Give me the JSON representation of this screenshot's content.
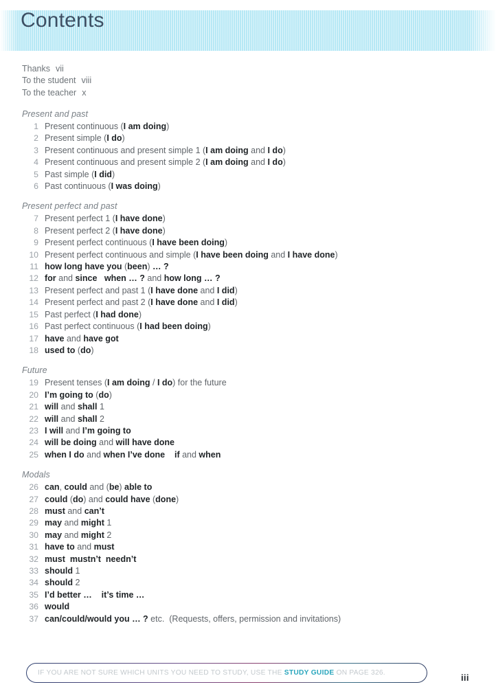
{
  "header": {
    "title": "Contents",
    "accent_color": "#b6e8f5"
  },
  "frontmatter": [
    {
      "label": "Thanks",
      "page": "vii"
    },
    {
      "label": "To the student",
      "page": "viii"
    },
    {
      "label": "To the teacher",
      "page": "x"
    }
  ],
  "sections": [
    {
      "title": "Present and past",
      "entries": [
        {
          "num": "1",
          "html": "Present continuous (<b>I am doing</b>)"
        },
        {
          "num": "2",
          "html": "Present simple (<b>I do</b>)"
        },
        {
          "num": "3",
          "html": "Present continuous and present simple 1 (<b>I am doing</b> and <b>I do</b>)"
        },
        {
          "num": "4",
          "html": "Present continuous and present simple 2 (<b>I am doing</b> and <b>I do</b>)"
        },
        {
          "num": "5",
          "html": "Past simple (<b>I did</b>)"
        },
        {
          "num": "6",
          "html": "Past continuous (<b>I was doing</b>)"
        }
      ]
    },
    {
      "title": "Present perfect and past",
      "entries": [
        {
          "num": "7",
          "html": "Present perfect 1 (<b>I have done</b>)"
        },
        {
          "num": "8",
          "html": "Present perfect 2 (<b>I have done</b>)"
        },
        {
          "num": "9",
          "html": "Present perfect continuous (<b>I have been doing</b>)"
        },
        {
          "num": "10",
          "html": "Present perfect continuous and simple (<b>I have been doing</b> and <b>I have done</b>)"
        },
        {
          "num": "11",
          "html": "<b>how long have you</b> (<b>been</b>) <b>… ?</b>"
        },
        {
          "num": "12",
          "html": "<b>for</b> and <b>since</b>   <b>when … ?</b> and <b>how long … ?</b>"
        },
        {
          "num": "13",
          "html": "Present perfect and past 1 (<b>I have done</b> and <b>I did</b>)"
        },
        {
          "num": "14",
          "html": "Present perfect and past 2 (<b>I have done</b> and <b>I did</b>)"
        },
        {
          "num": "15",
          "html": "Past perfect (<b>I had done</b>)"
        },
        {
          "num": "16",
          "html": "Past perfect continuous (<b>I had been doing</b>)"
        },
        {
          "num": "17",
          "html": "<b>have</b> and <b>have got</b>"
        },
        {
          "num": "18",
          "html": "<b>used to</b> (<b>do</b>)"
        }
      ]
    },
    {
      "title": "Future",
      "entries": [
        {
          "num": "19",
          "html": "Present tenses (<b>I am doing</b> / <b>I do</b>) for the future"
        },
        {
          "num": "20",
          "html": "<b>I’m going to</b> (<b>do</b>)"
        },
        {
          "num": "21",
          "html": "<b>will</b> and <b>shall</b> 1"
        },
        {
          "num": "22",
          "html": "<b>will</b> and <b>shall</b> 2"
        },
        {
          "num": "23",
          "html": "<b>I will</b> and <b>I’m going to</b>"
        },
        {
          "num": "24",
          "html": "<b>will be doing</b> and <b>will have done</b>"
        },
        {
          "num": "25",
          "html": "<b>when I do</b> and <b>when I’ve done</b>    <b>if</b> and <b>when</b>"
        }
      ]
    },
    {
      "title": "Modals",
      "entries": [
        {
          "num": "26",
          "html": "<b>can</b>, <b>could</b> and (<b>be</b>) <b>able to</b>"
        },
        {
          "num": "27",
          "html": "<b>could</b> (<b>do</b>) and <b>could have</b> (<b>done</b>)"
        },
        {
          "num": "28",
          "html": "<b>must</b> and <b>can’t</b>"
        },
        {
          "num": "29",
          "html": "<b>may</b> and <b>might</b> 1"
        },
        {
          "num": "30",
          "html": "<b>may</b> and <b>might</b> 2"
        },
        {
          "num": "31",
          "html": "<b>have to</b> and <b>must</b>"
        },
        {
          "num": "32",
          "html": "<b>must</b>  <b>mustn’t</b>  <b>needn’t</b>"
        },
        {
          "num": "33",
          "html": "<b>should</b> 1"
        },
        {
          "num": "34",
          "html": "<b>should</b> 2"
        },
        {
          "num": "35",
          "html": "<b>I’d better …</b>    <b>it’s time …</b>"
        },
        {
          "num": "36",
          "html": "<b>would</b>"
        },
        {
          "num": "37",
          "html": "<b>can/could/would you … ?</b> etc.  (Requests, offers, permission and invitations)"
        }
      ]
    }
  ],
  "footer": {
    "note_html": "IF YOU ARE NOT SURE WHICH UNITS YOU NEED TO STUDY, USE THE <b>STUDY GUIDE</b> ON PAGE 326.",
    "highlight_color": "#2aa6bd",
    "page_number": "iii"
  }
}
